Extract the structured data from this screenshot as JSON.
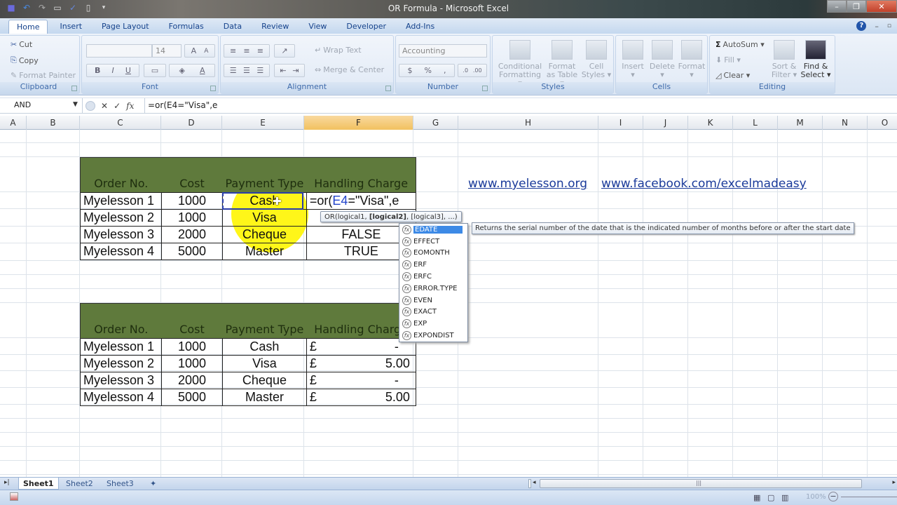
{
  "window": {
    "title": "OR Formula - Microsoft Excel",
    "quick_access": [
      "save-icon",
      "undo-icon",
      "redo-icon",
      "print-preview-icon",
      "spelling-icon",
      "new-icon",
      "customize-icon"
    ],
    "controls": {
      "minimize": "–",
      "restore": "❐",
      "close": "✕"
    }
  },
  "ribbon_tabs": [
    {
      "label": "Home",
      "active": true
    },
    {
      "label": "Insert"
    },
    {
      "label": "Page Layout"
    },
    {
      "label": "Formulas"
    },
    {
      "label": "Data"
    },
    {
      "label": "Review"
    },
    {
      "label": "View"
    },
    {
      "label": "Developer"
    },
    {
      "label": "Add-Ins"
    }
  ],
  "ribbon": {
    "clipboard": {
      "label": "Clipboard",
      "cut": "Cut",
      "copy": "Copy",
      "format_painter": "Format Painter"
    },
    "font": {
      "label": "Font",
      "font_name": "",
      "font_size": "14",
      "bold": "B",
      "italic": "I",
      "underline": "U"
    },
    "alignment": {
      "label": "Alignment",
      "wrap_text": "Wrap Text",
      "merge_center": "Merge & Center"
    },
    "number": {
      "label": "Number",
      "format": "Accounting",
      "currency": "$",
      "percent": "%",
      "comma": ","
    },
    "styles": {
      "label": "Styles",
      "conditional": "Conditional\nFormatting",
      "conditional_1": "Conditional",
      "conditional_2": "Formatting ▾",
      "format_table_1": "Format",
      "format_table_2": "as Table ▾",
      "cell_styles_1": "Cell",
      "cell_styles_2": "Styles ▾"
    },
    "cells": {
      "label": "Cells",
      "insert": "Insert",
      "delete": "Delete",
      "format": "Format"
    },
    "editing": {
      "label": "Editing",
      "autosum": "AutoSum ▾",
      "fill": "Fill ▾",
      "clear": "Clear ▾",
      "sort_1": "Sort &",
      "sort_2": "Filter ▾",
      "find_1": "Find &",
      "find_2": "Select ▾"
    }
  },
  "formula_bar": {
    "name_box": "AND",
    "cancel": "✕",
    "enter": "✓",
    "fx": "fx",
    "formula": "=or(E4=\"Visa\",e"
  },
  "columns": [
    "A",
    "B",
    "C",
    "D",
    "E",
    "F",
    "G",
    "H",
    "I",
    "J",
    "K",
    "L",
    "M",
    "N",
    "O"
  ],
  "selected_column": "F",
  "table1": {
    "headers": [
      "Order No.",
      "Cost",
      "Payment Type",
      "Handling Charge"
    ],
    "rows": [
      [
        "Myelesson 1",
        "1000",
        "Cash",
        "=or(E4=\"Visa\",e"
      ],
      [
        "Myelesson 2",
        "1000",
        "Visa",
        ""
      ],
      [
        "Myelesson 3",
        "2000",
        "Cheque",
        "FALSE"
      ],
      [
        "Myelesson 4",
        "5000",
        "Master",
        "TRUE"
      ]
    ],
    "editing_formula_parts": {
      "prefix": "=or(",
      "ref": "E4",
      "suffix": "=\"Visa\",e"
    }
  },
  "table2": {
    "headers": [
      "Order No.",
      "Cost",
      "Payment Type",
      "Handling Charge"
    ],
    "rows": [
      {
        "order": "Myelesson 1",
        "cost": "1000",
        "type": "Cash",
        "currency": "£",
        "charge": "-"
      },
      {
        "order": "Myelesson 2",
        "cost": "1000",
        "type": "Visa",
        "currency": "£",
        "charge": "5.00"
      },
      {
        "order": "Myelesson 3",
        "cost": "2000",
        "type": "Cheque",
        "currency": "£",
        "charge": "-"
      },
      {
        "order": "Myelesson 4",
        "cost": "5000",
        "type": "Master",
        "currency": "£",
        "charge": "5.00"
      }
    ]
  },
  "links": {
    "site": "www.myelesson.org",
    "facebook": "www.facebook.com/excelmadeasy"
  },
  "tooltip": {
    "pre": "OR(logical1, ",
    "bold": "[logical2]",
    "post": ", [logical3], ...)"
  },
  "autocomplete": {
    "items": [
      "EDATE",
      "EFFECT",
      "EOMONTH",
      "ERF",
      "ERFC",
      "ERROR.TYPE",
      "EVEN",
      "EXACT",
      "EXP",
      "EXPONDIST"
    ],
    "selected": "EDATE",
    "description": "Returns the serial number of the date that is the indicated number of months before or after the start date"
  },
  "sheets": [
    {
      "label": "Sheet1",
      "active": true
    },
    {
      "label": "Sheet2"
    },
    {
      "label": "Sheet3"
    }
  ],
  "status": {
    "zoom": "100%"
  }
}
